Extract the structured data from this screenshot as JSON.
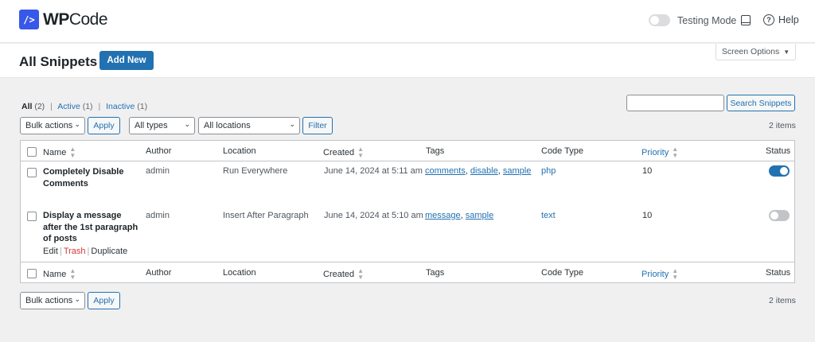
{
  "app": {
    "logo_mark": "/>",
    "logo_bold": "WP",
    "logo_rest": "Code"
  },
  "topbar": {
    "testing_mode_label": "Testing Mode",
    "help_label": "Help"
  },
  "header": {
    "title": "All Snippets",
    "add_new_label": "Add New",
    "screen_options_label": "Screen Options"
  },
  "views": {
    "all_label": "All",
    "all_count": "(2)",
    "active_label": "Active",
    "active_count": "(1)",
    "inactive_label": "Inactive",
    "inactive_count": "(1)"
  },
  "search": {
    "button_label": "Search Snippets",
    "value": ""
  },
  "filters": {
    "bulk_actions": "Bulk actions",
    "apply_label": "Apply",
    "type_select": "All types",
    "location_select": "All locations",
    "filter_label": "Filter",
    "items_count": "2 items"
  },
  "table": {
    "columns": {
      "name": "Name",
      "author": "Author",
      "location": "Location",
      "created": "Created",
      "tags": "Tags",
      "code_type": "Code Type",
      "priority": "Priority",
      "status": "Status"
    },
    "rows": [
      {
        "title_line1": "Completely Disable",
        "title_line2": "Comments",
        "author": "admin",
        "location": "Run Everywhere",
        "created": "June 14, 2024 at 5:11 am",
        "tags": [
          "comments",
          "disable",
          "sample"
        ],
        "code_type": "php",
        "priority": "10",
        "status_on": true
      },
      {
        "title_line1": "Display a message",
        "title_line2": "after the 1st paragraph",
        "title_line3": "of posts",
        "author": "admin",
        "location": "Insert After Paragraph",
        "created": "June 14, 2024 at 5:10 am",
        "tags": [
          "message",
          "sample"
        ],
        "code_type": "text",
        "priority": "10",
        "status_on": false,
        "row_actions": {
          "edit": "Edit",
          "trash": "Trash",
          "duplicate": "Duplicate"
        }
      }
    ]
  },
  "bottom": {
    "bulk_actions": "Bulk actions",
    "apply_label": "Apply",
    "items_count": "2 items"
  },
  "colors": {
    "accent": "#2271b1",
    "brand": "#3858e9",
    "danger": "#d63638"
  },
  "icons": {
    "sort": "sort-arrows-icon",
    "help": "help-circle-icon",
    "panel": "panel-icon",
    "chevron": "chevron-down-icon"
  }
}
